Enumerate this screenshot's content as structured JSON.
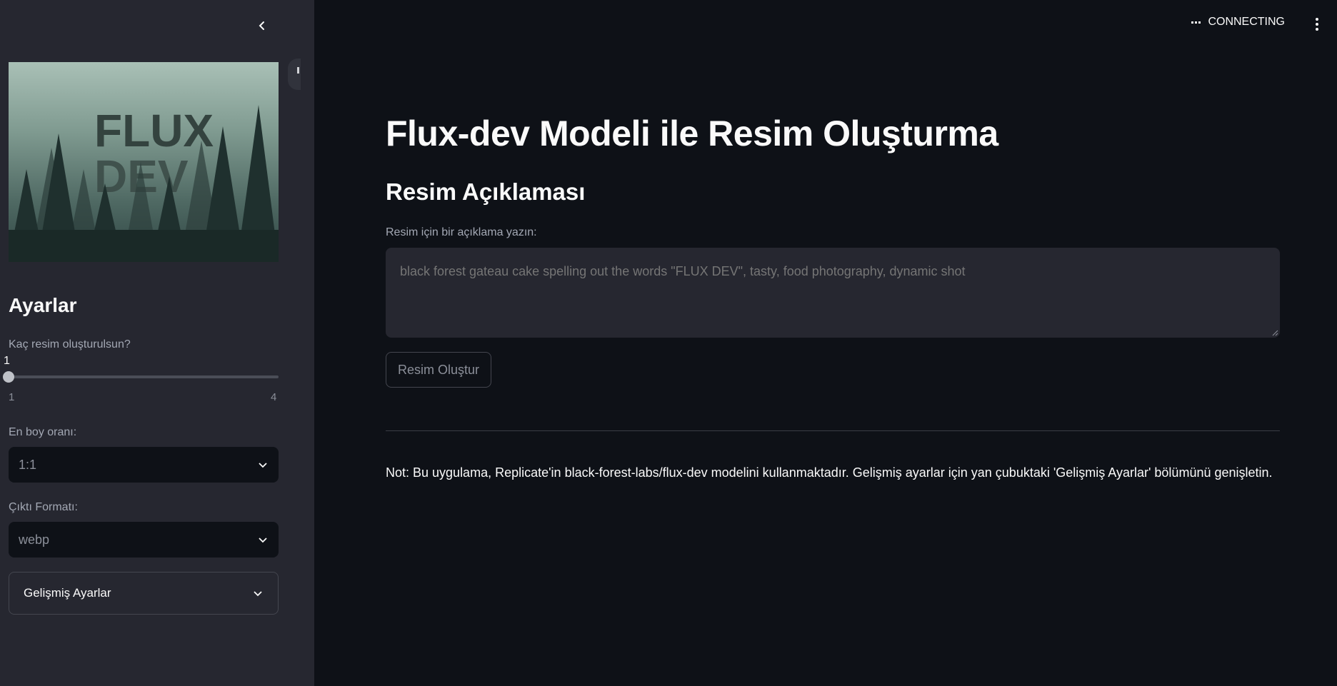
{
  "sidebar": {
    "logo_text": [
      "FLUX",
      "DEV"
    ],
    "title": "Ayarlar",
    "num_images": {
      "label": "Kaç resim oluşturulsun?",
      "value": "1",
      "min": "1",
      "max": "4",
      "fraction": 0
    },
    "aspect_ratio": {
      "label": "En boy oranı:",
      "selected": "1:1"
    },
    "output_format": {
      "label": "Çıktı Formatı:",
      "selected": "webp"
    },
    "advanced": {
      "label": "Gelişmiş Ayarlar"
    }
  },
  "topbar": {
    "status": "CONNECTING"
  },
  "main": {
    "title": "Flux-dev Modeli ile Resim Oluşturma",
    "subtitle": "Resim Açıklaması",
    "prompt_label": "Resim için bir açıklama yazın:",
    "prompt_placeholder": "black forest gateau cake spelling out the words \"FLUX DEV\", tasty, food photography, dynamic shot",
    "generate_button": "Resim Oluştur",
    "note": "Not: Bu uygulama, Replicate'in black-forest-labs/flux-dev modelini kullanmaktadır. Gelişmiş ayarlar için yan çubuktaki 'Gelişmiş Ayarlar' bölümünü genişletin."
  },
  "colors": {
    "background": "#0e1117",
    "sidebar": "#262730",
    "text": "#fafafa",
    "muted": "#a3a8b4"
  }
}
